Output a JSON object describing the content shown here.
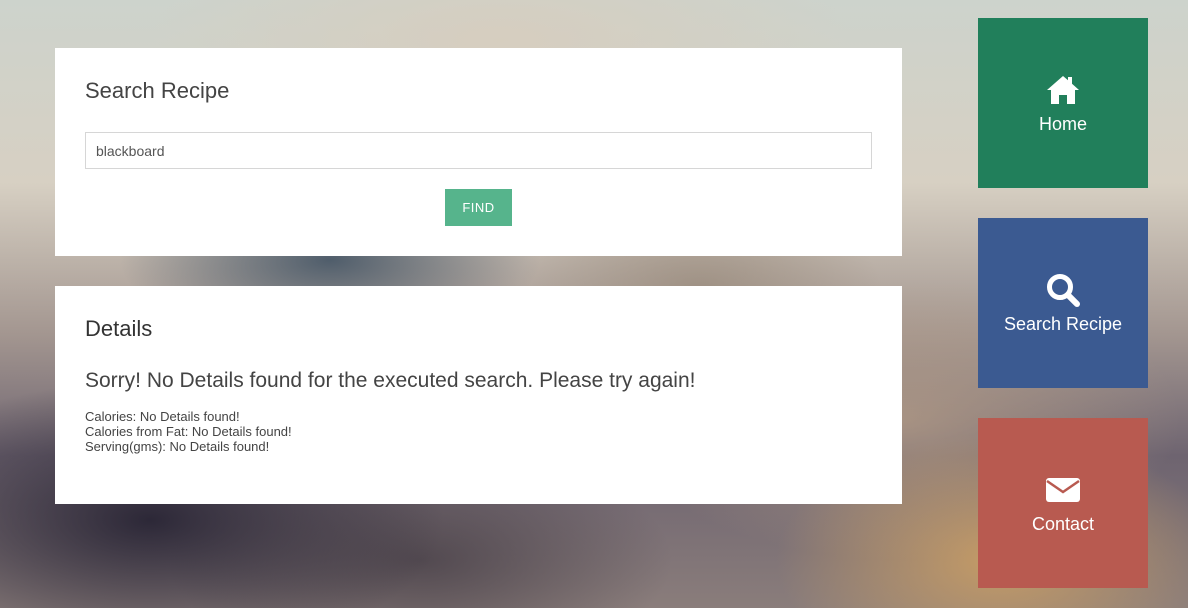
{
  "search": {
    "title": "Search Recipe",
    "input_value": "blackboard",
    "find_label": "FIND"
  },
  "details": {
    "title": "Details",
    "message": "Sorry! No Details found for the executed search. Please try again!",
    "lines": [
      "Calories: No Details found!",
      "Calories from Fat: No Details found!",
      "Serving(gms): No Details found!"
    ]
  },
  "nav": {
    "tiles": [
      {
        "label": "Home",
        "icon": "home-icon",
        "color": "#217f5b"
      },
      {
        "label": "Search Recipe",
        "icon": "search-icon",
        "color": "#3b5a91"
      },
      {
        "label": "Contact",
        "icon": "envelope-icon",
        "color": "#b85a50"
      }
    ]
  },
  "colors": {
    "find_button": "#56b48c",
    "panel_bg": "#ffffff"
  }
}
